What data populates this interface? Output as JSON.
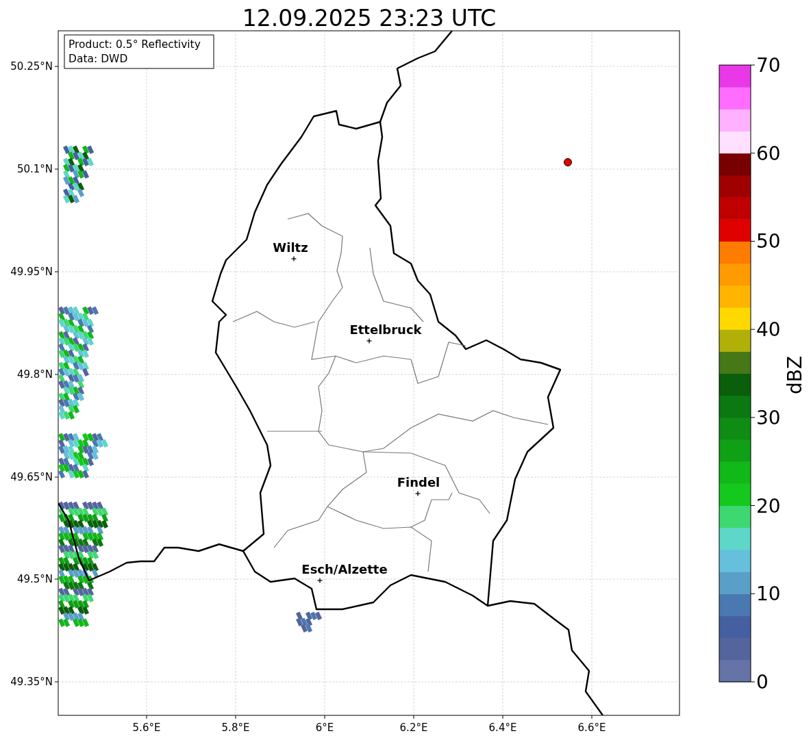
{
  "title": "12.09.2025 23:23 UTC",
  "info_box": [
    "Product: 0.5° Reflectivity",
    "Data: DWD"
  ],
  "map": {
    "xticks": [
      "5.6°E",
      "5.8°E",
      "6°E",
      "6.2°E",
      "6.4°E",
      "6.6°E"
    ],
    "yticks": [
      "50.25°N",
      "50.1°N",
      "49.95°N",
      "49.8°N",
      "49.65°N",
      "49.5°N",
      "49.35°N"
    ],
    "cities": [
      {
        "name": "Wiltz"
      },
      {
        "name": "Ettelbruck"
      },
      {
        "name": "Findel"
      },
      {
        "name": "Esch/Alzette"
      }
    ]
  },
  "colorbar": {
    "label": "dBZ",
    "ticks": [
      "70",
      "60",
      "50",
      "40",
      "30",
      "20",
      "10",
      "0"
    ],
    "segments": [
      {
        "color": "#6673a6"
      },
      {
        "color": "#54659d"
      },
      {
        "color": "#4560a0"
      },
      {
        "color": "#4a78b0"
      },
      {
        "color": "#5a9fc8"
      },
      {
        "color": "#64c0dc"
      },
      {
        "color": "#5ed6c8"
      },
      {
        "color": "#3ed870"
      },
      {
        "color": "#14c81e"
      },
      {
        "color": "#10b818"
      },
      {
        "color": "#10a016"
      },
      {
        "color": "#0e8c14"
      },
      {
        "color": "#0b7812"
      },
      {
        "color": "#0a5e0c"
      },
      {
        "color": "#467818"
      },
      {
        "color": "#b0b008"
      },
      {
        "color": "#ffd800"
      },
      {
        "color": "#ffb400"
      },
      {
        "color": "#ff9a00"
      },
      {
        "color": "#ff7c00"
      },
      {
        "color": "#e00000"
      },
      {
        "color": "#c00000"
      },
      {
        "color": "#a00000"
      },
      {
        "color": "#780000"
      },
      {
        "color": "#ffe0ff"
      },
      {
        "color": "#ffb0ff"
      },
      {
        "color": "#ff6cff"
      },
      {
        "color": "#e838e8"
      }
    ]
  }
}
